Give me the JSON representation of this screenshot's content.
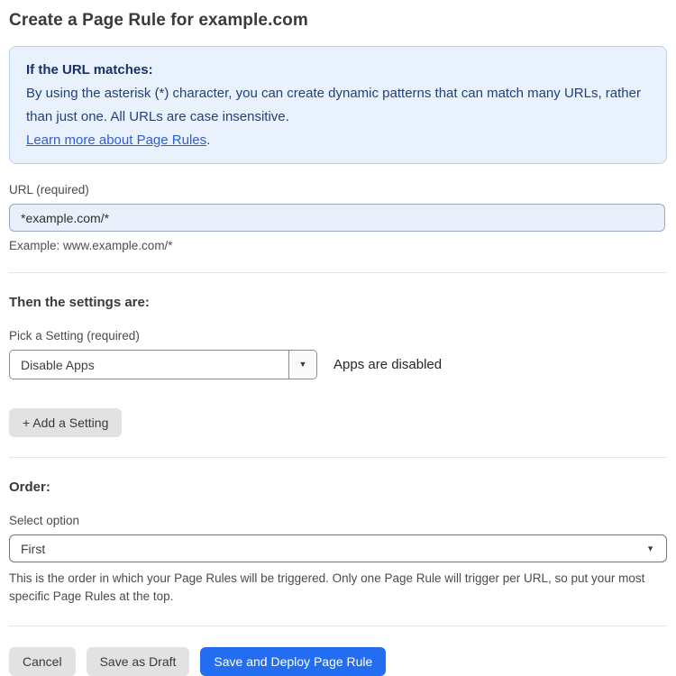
{
  "page": {
    "title": "Create a Page Rule for example.com"
  },
  "info_box": {
    "heading": "If the URL matches:",
    "body": "By using the asterisk (*) character, you can create dynamic patterns that can match many URLs, rather than just one. All URLs are case insensitive.",
    "link_label": "Learn more about Page Rules",
    "link_suffix": "."
  },
  "url_field": {
    "label": "URL (required)",
    "value": "*example.com/*",
    "helper": "Example: www.example.com/*"
  },
  "settings_section": {
    "heading": "Then the settings are:",
    "picker_label": "Pick a Setting (required)",
    "picker_value": "Disable Apps",
    "caret_glyph": "▼",
    "status_text": "Apps are disabled",
    "add_setting_label": "+ Add a Setting"
  },
  "order_section": {
    "heading": "Order:",
    "select_label": "Select option",
    "select_value": "First",
    "caret_glyph": "▼",
    "helper": "This is the order in which your Page Rules will be triggered. Only one Page Rule will trigger per URL, so put your most specific Page Rules at the top."
  },
  "actions": {
    "cancel_label": "Cancel",
    "save_draft_label": "Save as Draft",
    "save_deploy_label": "Save and Deploy Page Rule"
  },
  "colors": {
    "info_bg": "#e9f2fc",
    "info_border": "#b8d3f1",
    "info_text": "#23407a",
    "info_heading": "#17326b",
    "link_color": "#2d5ed9",
    "input_bg": "#e9f0fc",
    "input_border": "#9aa7bd",
    "btn_gray": "#e2e2e2",
    "primary_blue": "#236ef0"
  }
}
